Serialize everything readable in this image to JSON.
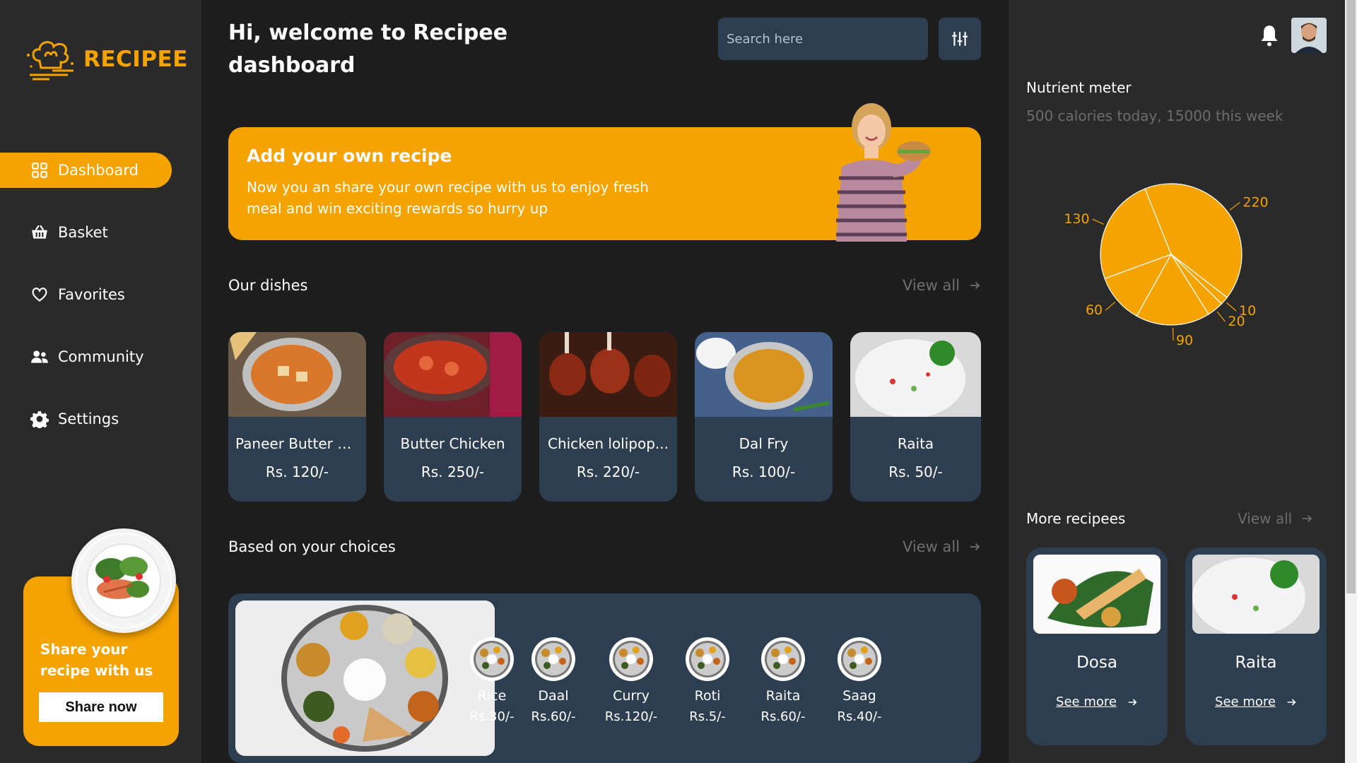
{
  "brand": {
    "name": "RECIPEE",
    "color": "#f5a300"
  },
  "sidebar": {
    "items": [
      {
        "label": "Dashboard",
        "icon": "grid-icon",
        "active": true
      },
      {
        "label": "Basket",
        "icon": "basket-icon"
      },
      {
        "label": "Favorites",
        "icon": "heart-icon"
      },
      {
        "label": "Community",
        "icon": "people-icon"
      },
      {
        "label": "Settings",
        "icon": "gear-icon"
      }
    ],
    "share": {
      "text": "Share your recipe with us",
      "button": "Share now"
    }
  },
  "header": {
    "welcome": "Hi, welcome to Recipee dashboard",
    "search_placeholder": "Search here"
  },
  "banner": {
    "title": "Add your own recipe",
    "text": "Now you an share your own recipe with us to enjoy fresh meal and win exciting rewards so hurry up"
  },
  "dishes": {
    "title": "Our dishes",
    "view_all": "View all",
    "items": [
      {
        "name": "Paneer Butter M...",
        "price": "Rs. 120/-"
      },
      {
        "name": "Butter Chicken",
        "price": "Rs. 250/-"
      },
      {
        "name": "Chicken lolipop...",
        "price": "Rs. 220/-"
      },
      {
        "name": "Dal Fry",
        "price": "Rs. 100/-"
      },
      {
        "name": "Raita",
        "price": "Rs. 50/-"
      }
    ]
  },
  "choices": {
    "title": "Based on your choices",
    "view_all": "View all",
    "items": [
      {
        "name": "Rice",
        "price": "Rs.30/-"
      },
      {
        "name": "Daal",
        "price": "Rs.60/-"
      },
      {
        "name": "Curry",
        "price": "Rs.120/-"
      },
      {
        "name": "Roti",
        "price": "Rs.5/-"
      },
      {
        "name": "Raita",
        "price": "Rs.60/-"
      },
      {
        "name": "Saag",
        "price": "Rs.40/-"
      }
    ]
  },
  "nutrient": {
    "title": "Nutrient meter",
    "subtitle": "500 calories today, 15000 this week"
  },
  "chart_data": {
    "type": "pie",
    "categories": [
      "220",
      "10",
      "20",
      "90",
      "60",
      "130"
    ],
    "values": [
      220,
      10,
      20,
      90,
      60,
      130
    ],
    "labels": [
      "220",
      "10",
      "20",
      "90",
      "60",
      "130"
    ]
  },
  "more": {
    "title": "More recipees",
    "view_all": "View all",
    "items": [
      {
        "name": "Dosa",
        "link": "See more"
      },
      {
        "name": "Raita",
        "link": "See more"
      }
    ]
  }
}
